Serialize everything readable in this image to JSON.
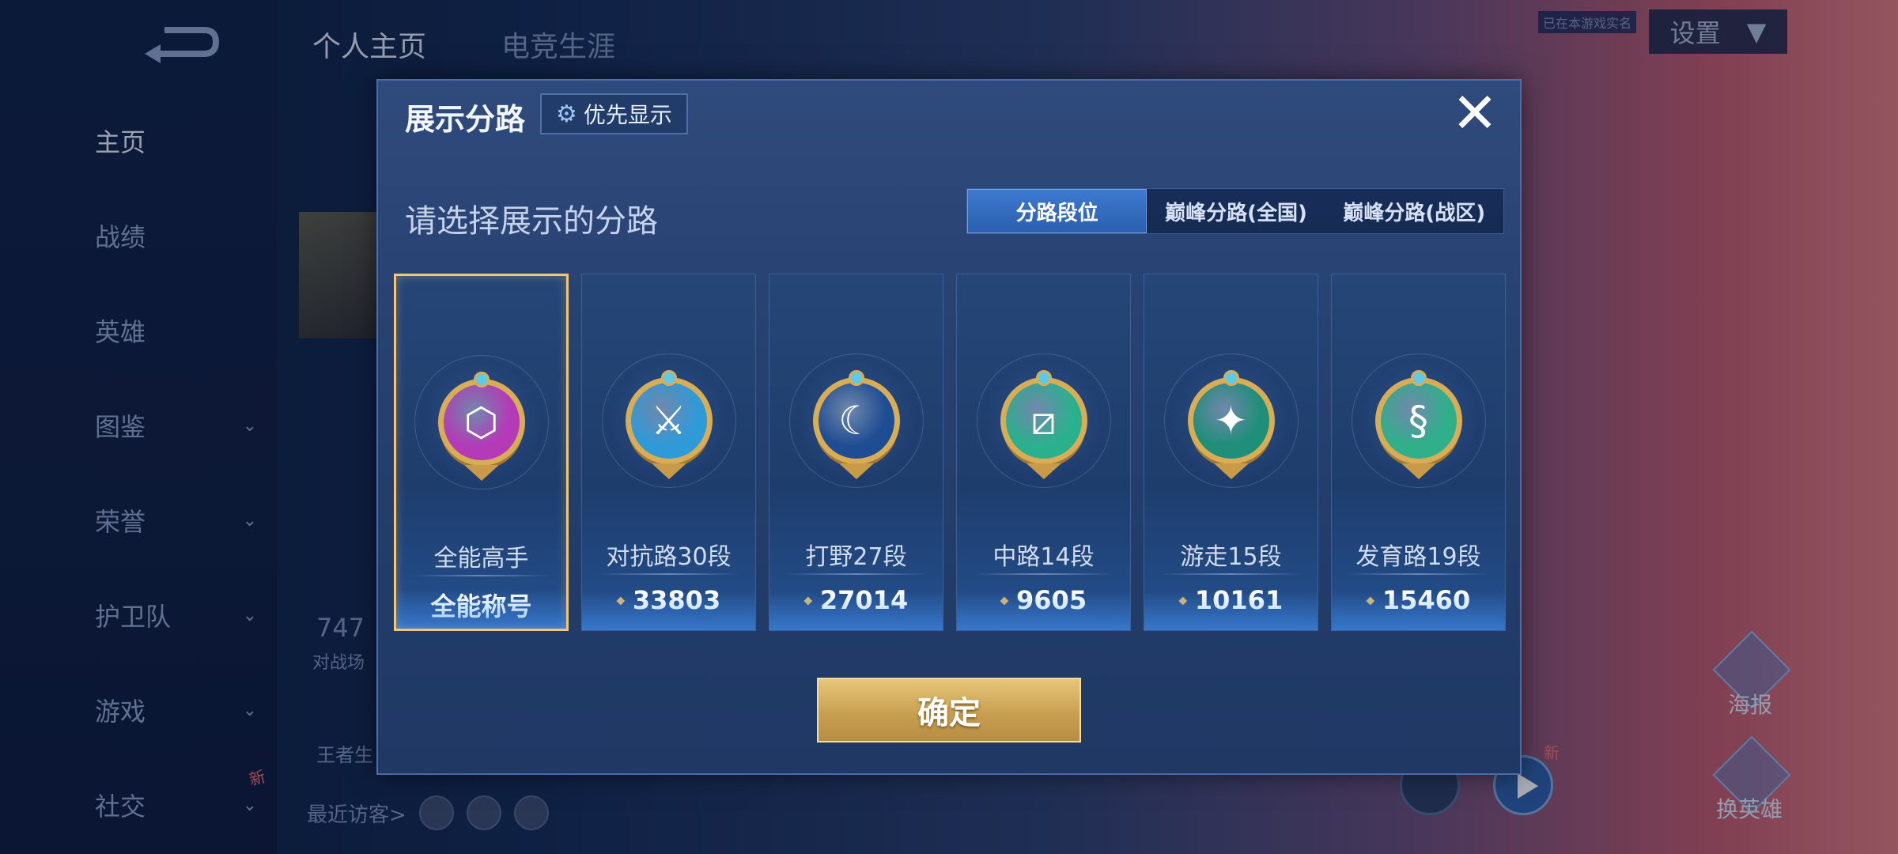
{
  "background": {
    "top_tabs": [
      "个人主页",
      "电竞生涯"
    ],
    "sidebar": [
      {
        "label": "主页",
        "chevron": false
      },
      {
        "label": "战绩",
        "chevron": false
      },
      {
        "label": "英雄",
        "chevron": false
      },
      {
        "label": "图鉴",
        "chevron": true
      },
      {
        "label": "荣誉",
        "chevron": true
      },
      {
        "label": "护卫队",
        "chevron": true
      },
      {
        "label": "游戏",
        "chevron": true
      },
      {
        "label": "社交",
        "chevron": true
      }
    ],
    "new_badge": "新",
    "left_number": "747",
    "left_sub": "对战场",
    "left_wangzhe": "王者生",
    "recent_visitors": "最近访客>",
    "settings_label": "设置",
    "settings_note": "已在本游戏实名",
    "poster_label": "海报",
    "swap_hero_label": "换英雄",
    "new_badge_right": "新"
  },
  "dialog": {
    "title": "展示分路",
    "priority_button": "优先显示",
    "subtitle": "请选择展示的分路",
    "tabs": [
      {
        "label": "分路段位",
        "active": true
      },
      {
        "label": "巅峰分路(全国)",
        "active": false
      },
      {
        "label": "巅峰分路(战区)",
        "active": false
      }
    ],
    "cards": [
      {
        "name": "全能高手",
        "value": "全能称号",
        "has_points_icon": false,
        "icon": "allround-emblem-icon",
        "color": "#b53ab8",
        "glyph": "⬡",
        "selected": true
      },
      {
        "name": "对抗路30段",
        "value": "33803",
        "has_points_icon": true,
        "icon": "clash-lane-emblem-icon",
        "color": "#2f9ad8",
        "glyph": "⚔",
        "selected": false
      },
      {
        "name": "打野27段",
        "value": "27014",
        "has_points_icon": true,
        "icon": "jungle-emblem-icon",
        "color": "#1f4d93",
        "glyph": "☾",
        "selected": false
      },
      {
        "name": "中路14段",
        "value": "9605",
        "has_points_icon": true,
        "icon": "mid-lane-emblem-icon",
        "color": "#2bb08e",
        "glyph": "⧄",
        "selected": false
      },
      {
        "name": "游走15段",
        "value": "10161",
        "has_points_icon": true,
        "icon": "roam-emblem-icon",
        "color": "#1f8f7a",
        "glyph": "✦",
        "selected": false
      },
      {
        "name": "发育路19段",
        "value": "15460",
        "has_points_icon": true,
        "icon": "farm-lane-emblem-icon",
        "color": "#2fb08a",
        "glyph": "§",
        "selected": false
      }
    ],
    "confirm_label": "确定",
    "points_icon": "points-icon"
  }
}
